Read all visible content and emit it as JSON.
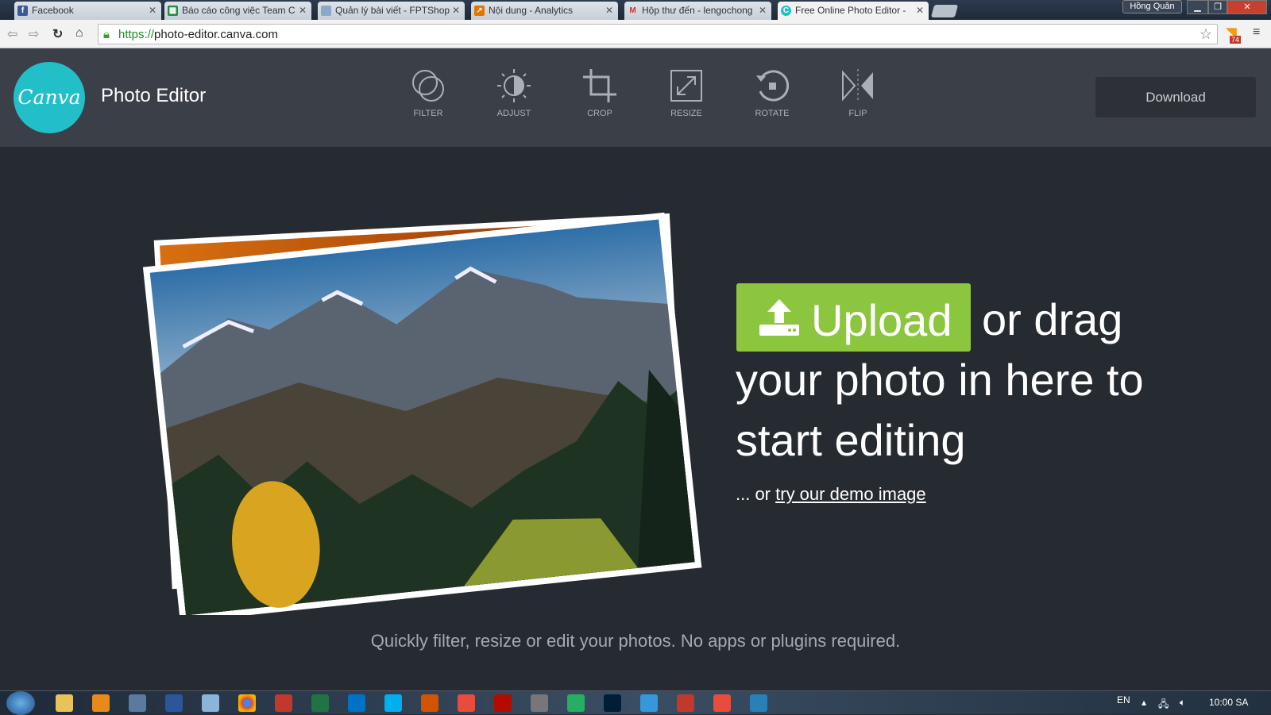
{
  "browser": {
    "tabs": [
      {
        "label": "Facebook",
        "icon": "facebook-icon",
        "color": "#3b5998"
      },
      {
        "label": "Báo cáo công việc Team C",
        "icon": "sheets-icon",
        "color": "#1e8e3e"
      },
      {
        "label": "Quản lý bài viết - FPTShop",
        "icon": "page-icon",
        "color": "#8aa8c8"
      },
      {
        "label": "Nội dung - Analytics",
        "icon": "analytics-icon",
        "color": "#e37400"
      },
      {
        "label": "Hộp thư đến - lengochong",
        "icon": "gmail-icon",
        "color": "#d93025"
      },
      {
        "label": "Free Online Photo Editor -",
        "icon": "canva-icon",
        "color": "#23bfc8"
      }
    ],
    "user": "Hồng Quân",
    "url_scheme": "https://",
    "url_rest": "photo-editor.canva.com",
    "rss_badge": "74"
  },
  "app": {
    "logo": "Canva",
    "title": "Photo Editor",
    "tools": [
      {
        "label": "FILTER",
        "icon": "filter-icon"
      },
      {
        "label": "ADJUST",
        "icon": "adjust-icon"
      },
      {
        "label": "CROP",
        "icon": "crop-icon"
      },
      {
        "label": "RESIZE",
        "icon": "resize-icon"
      },
      {
        "label": "ROTATE",
        "icon": "rotate-icon"
      },
      {
        "label": "FLIP",
        "icon": "flip-icon"
      }
    ],
    "download": "Download",
    "upload": "Upload",
    "headline": "or drag your photo in here to start editing",
    "demo_prefix": "... or ",
    "demo_link": "try our demo image",
    "tagline": "Quickly filter, resize or edit your photos. No apps or plugins required.",
    "accent": "#8cc63f"
  },
  "taskbar": {
    "lang": "EN",
    "clock": "10:00 SA"
  }
}
